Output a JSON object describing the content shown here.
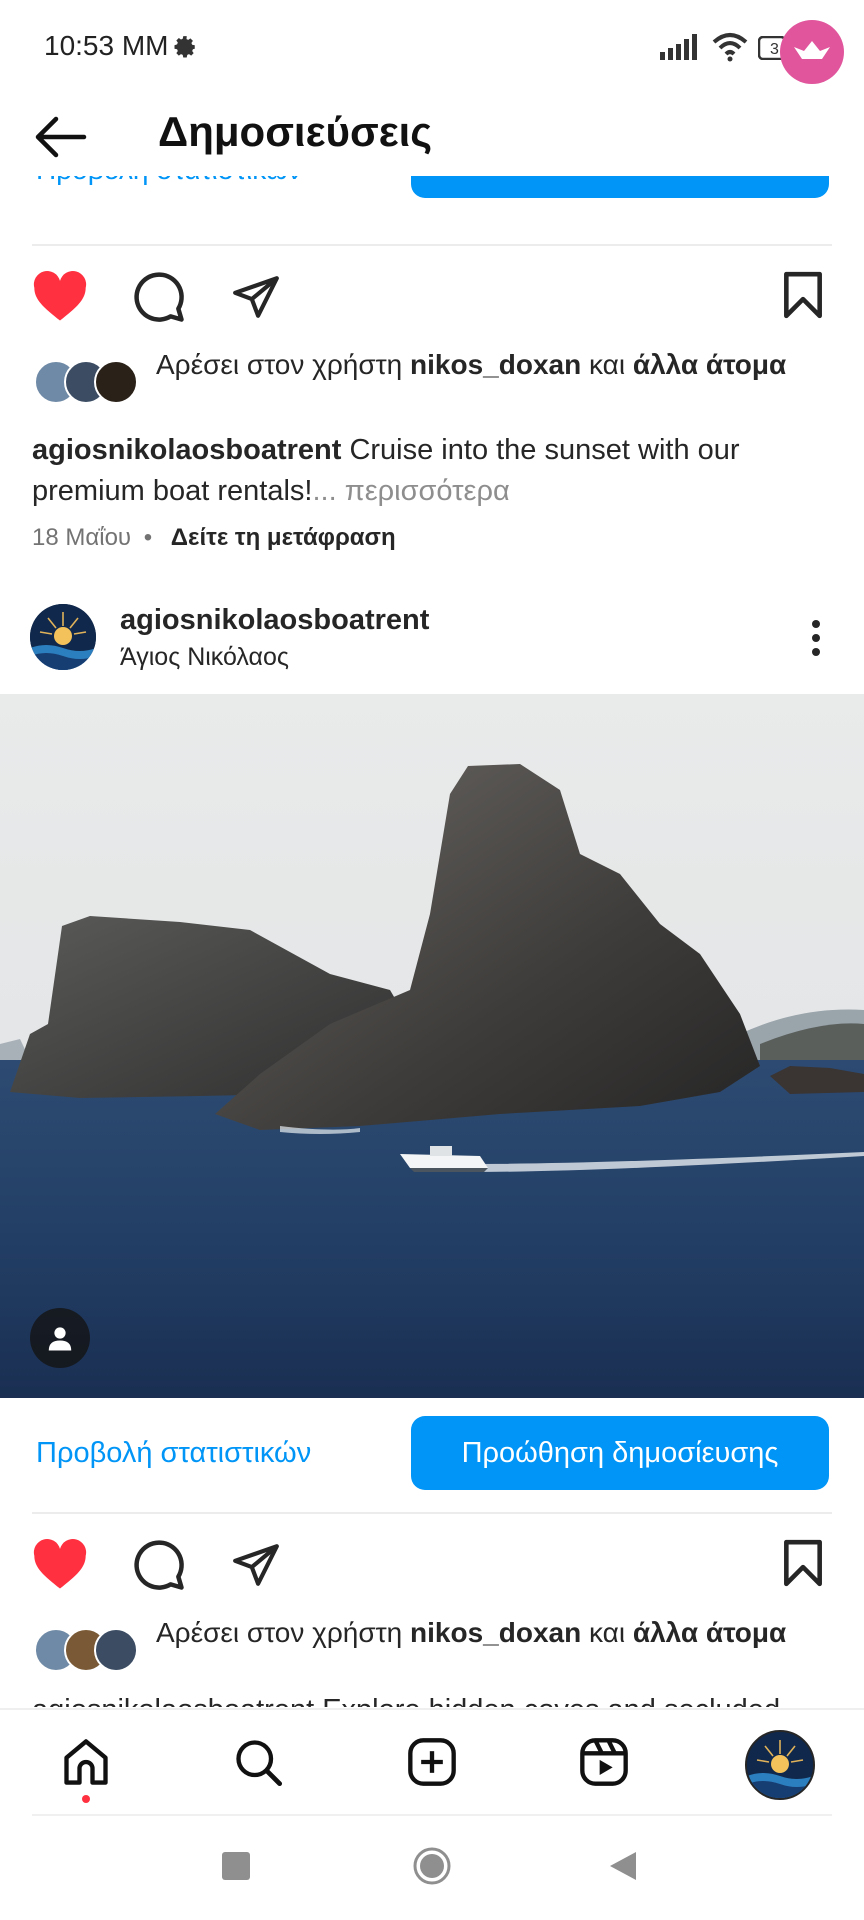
{
  "status_bar": {
    "time": "10:53 MM",
    "battery": "3"
  },
  "header": {
    "title": "Δημοσιεύσεις"
  },
  "post_prev": {
    "likers_prefix": "Αρέσει στον χρήστη",
    "liker_name": "nikos_doxan",
    "likers_and": "και",
    "likers_others": "άλλα άτομα",
    "caption_author": "agiosnikolaosboatrent",
    "caption_text": "Cruise into the sunset with our premium boat rentals!",
    "caption_more": "... περισσότερα",
    "date": "18 Μαΐου",
    "separator": "•",
    "translate": "Δείτε τη μετάφραση"
  },
  "post": {
    "author": "agiosnikolaosboatrent",
    "location": "Άγιος Νικόλαος",
    "insights_link": "Προβολή στατιστικών",
    "promote_button": "Προώθηση δημοσίευσης",
    "likers_prefix": "Αρέσει στον χρήστη",
    "liker_name": "nikos_doxan",
    "likers_and": "και",
    "likers_others": "άλλα άτομα",
    "caption_partial": "agiosnikolaosboatrent Explore hidden coves and secluded"
  },
  "bottom_nav": {
    "items": [
      "home-icon",
      "search-icon",
      "create-icon",
      "reels-icon",
      "profile-avatar"
    ],
    "active": "home-icon"
  },
  "colors": {
    "accent_blue": "#0095f6",
    "like_red": "#ff3040",
    "badge_pink": "#e0559c"
  }
}
